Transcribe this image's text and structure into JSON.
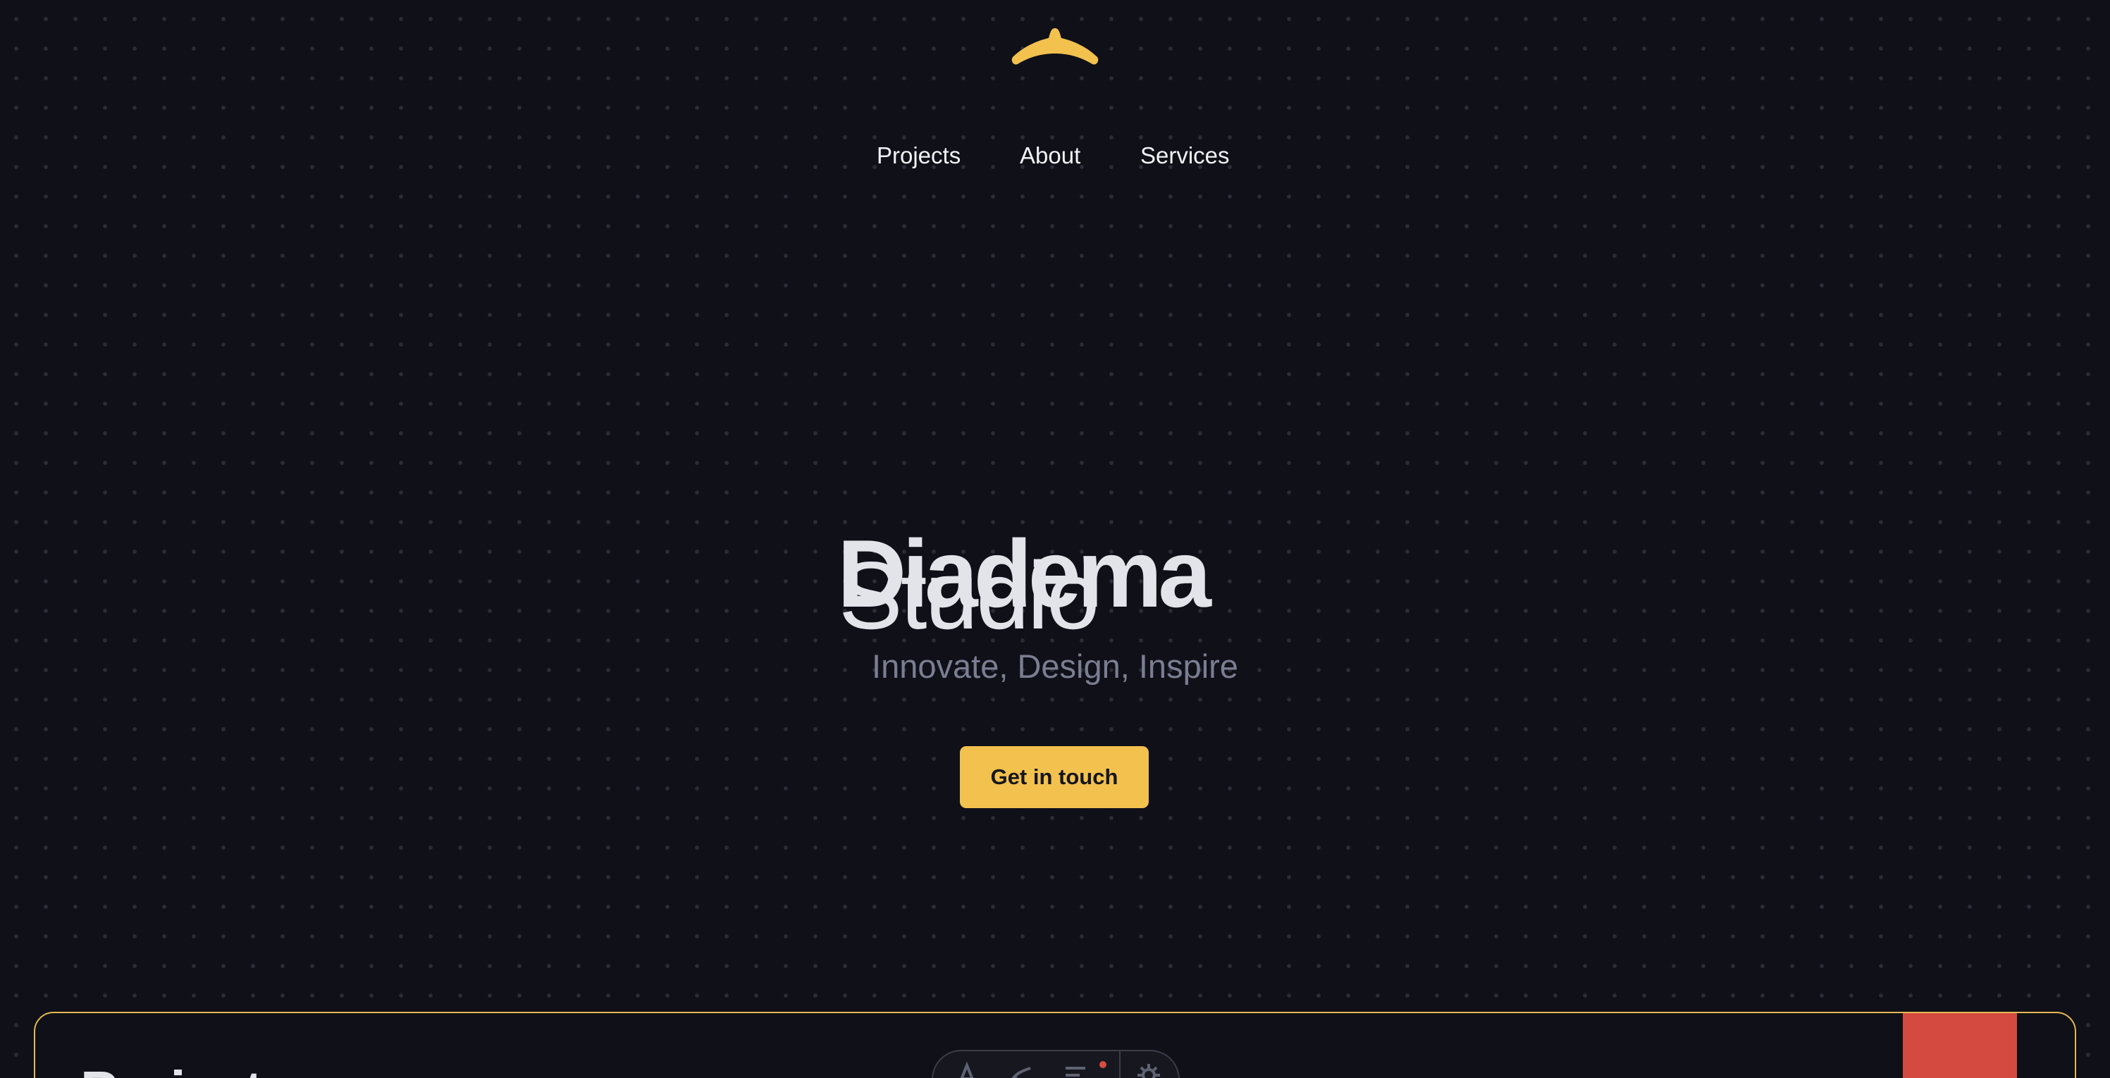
{
  "brand": {
    "logo_icon": "diadem-crown-icon",
    "accent_color": "#f2c14e"
  },
  "nav": {
    "items": [
      {
        "label": "Projects"
      },
      {
        "label": "About"
      },
      {
        "label": "Services"
      }
    ]
  },
  "hero": {
    "title": "Diadema",
    "subtitle": "Studio",
    "tagline": "Innovate, Design, Inspire",
    "cta_label": "Get in touch"
  },
  "projects_panel": {
    "heading": "Projects",
    "toolbar_icons": [
      "text-tool-icon",
      "brush-tool-icon",
      "align-tool-icon",
      "settings-icon"
    ]
  },
  "colors": {
    "background": "#0f1018",
    "text": "#e3e4ea",
    "muted": "#7b7e92",
    "panel_border": "#e5b851",
    "red_block": "#d44a41"
  }
}
